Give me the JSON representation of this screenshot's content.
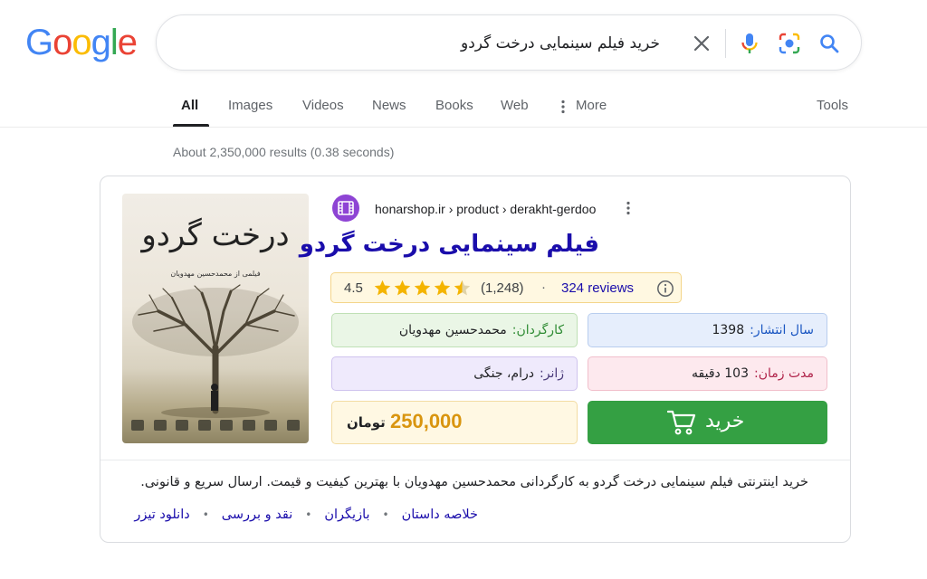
{
  "logo": {
    "letters": [
      "G",
      "o",
      "o",
      "g",
      "l",
      "e"
    ],
    "colors": [
      "#4285F4",
      "#EA4335",
      "#FBBC05",
      "#4285F4",
      "#34A853",
      "#EA4335"
    ]
  },
  "search": {
    "query": "خرید فیلم سینمایی درخت گردو"
  },
  "tabs": [
    {
      "label": "All",
      "active": true
    },
    {
      "label": "Images"
    },
    {
      "label": "Videos"
    },
    {
      "label": "News"
    },
    {
      "label": "Books"
    },
    {
      "label": "Web"
    },
    {
      "label": "More"
    }
  ],
  "tools_label": "Tools",
  "results_stats": "About 2,350,000 results (0.38 seconds)",
  "result": {
    "poster": {
      "title": "درخت گردو",
      "subtitle": "فیلمی از محمدحسین مهدویان"
    },
    "breadcrumb": "honarshop.ir › product › derakht-gerdoo",
    "title": "فیلم سینمایی درخت گردو",
    "rating": {
      "value": "4.5",
      "count": "(1,248)",
      "dot": "·",
      "reviews": "324 reviews",
      "stars": 4.5
    },
    "fields": {
      "director": {
        "label": "کارگردان:",
        "value": "محمدحسین مهدویان"
      },
      "year": {
        "label": "سال انتشار:",
        "value": "1398"
      },
      "genre": {
        "label": "ژانر:",
        "value": "درام، جنگی"
      },
      "duration": {
        "label": "مدت زمان:",
        "value": "103 دقیقه"
      }
    },
    "price": {
      "value": "250,000",
      "currency": "تومان"
    },
    "buy_label": "خرید",
    "description": "خرید اینترنتی فیلم سینمایی درخت گردو به کارگردانی محمدحسین مهدویان با بهترین کیفیت و قیمت. ارسال سریع و قانونی.",
    "sitelinks": [
      "خلاصه داستان",
      "بازیگران",
      "نقد و بررسی",
      "دانلود تیزر"
    ],
    "sitelink_separator": "•"
  },
  "colors": {
    "link": "#1a0dab",
    "accent_green": "#34a043",
    "price": "#d9950f",
    "site_icon": "#8e44d4"
  }
}
